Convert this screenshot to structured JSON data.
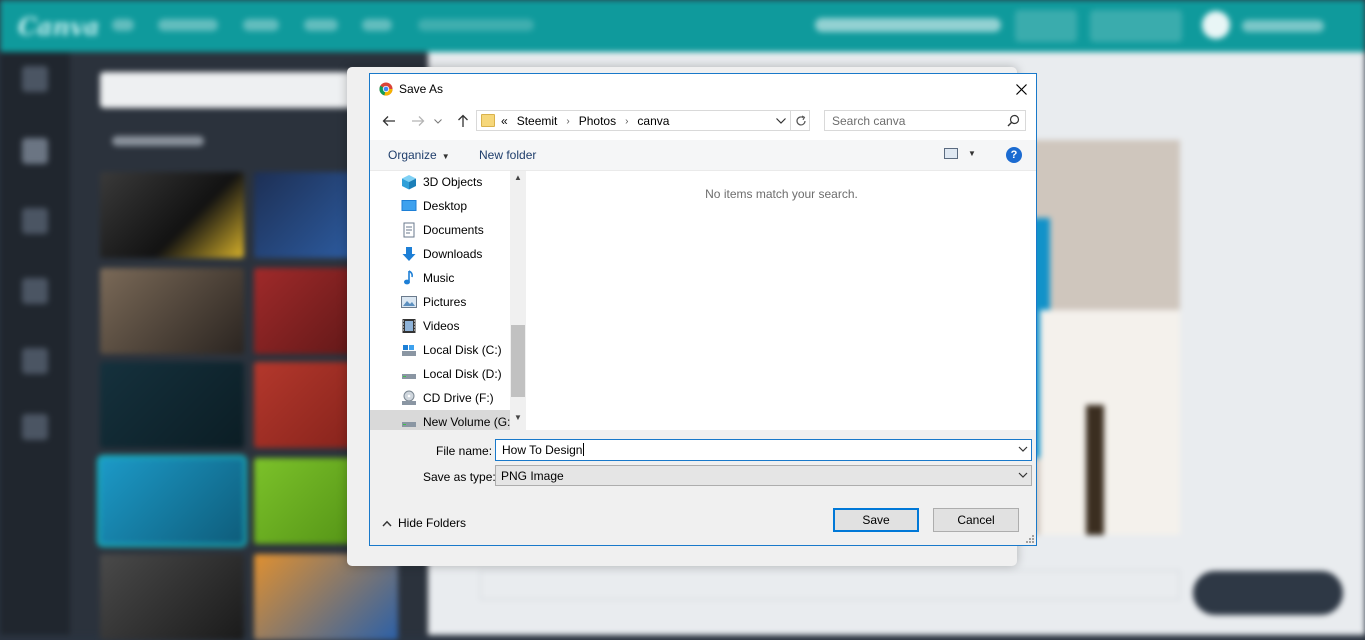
{
  "dialog": {
    "title": "Save As",
    "breadcrumb": [
      "«",
      "Steemit",
      "Photos",
      "canva"
    ],
    "search_placeholder": "Search canva",
    "toolbar": {
      "organize": "Organize",
      "new_folder": "New folder",
      "help": "?"
    },
    "tree": [
      {
        "label": "3D Objects",
        "icon": "3d-objects-icon"
      },
      {
        "label": "Desktop",
        "icon": "desktop-icon"
      },
      {
        "label": "Documents",
        "icon": "documents-icon"
      },
      {
        "label": "Downloads",
        "icon": "downloads-icon"
      },
      {
        "label": "Music",
        "icon": "music-icon"
      },
      {
        "label": "Pictures",
        "icon": "pictures-icon"
      },
      {
        "label": "Videos",
        "icon": "videos-icon"
      },
      {
        "label": "Local Disk (C:)",
        "icon": "local-disk-icon"
      },
      {
        "label": "Local Disk (D:)",
        "icon": "drive-icon"
      },
      {
        "label": "CD Drive (F:)",
        "icon": "cd-drive-icon"
      },
      {
        "label": "New Volume (G:",
        "icon": "drive-icon"
      }
    ],
    "empty_message": "No items match your search.",
    "file_name_label": "File name:",
    "file_name_value": "How To Design",
    "save_type_label": "Save as type:",
    "save_type_value": "PNG Image",
    "hide_folders": "Hide Folders",
    "save_button": "Save",
    "cancel_button": "Cancel"
  },
  "colors": {
    "accent": "#1979ca",
    "canva_teal": "#0f9a9c",
    "help_blue": "#1b6bd1"
  }
}
